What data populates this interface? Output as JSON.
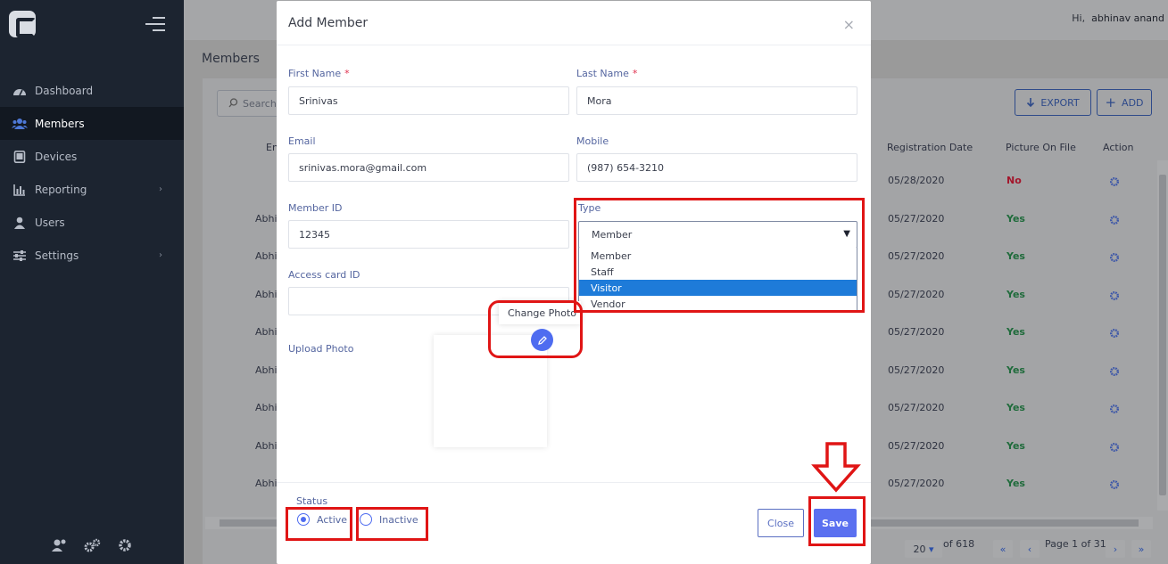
{
  "sidebar": {
    "items": [
      {
        "label": "Dashboard",
        "icon": "dashboard-icon",
        "chevron": false,
        "active": false
      },
      {
        "label": "Members",
        "icon": "users-icon",
        "chevron": false,
        "active": true
      },
      {
        "label": "Devices",
        "icon": "tablet-icon",
        "chevron": false,
        "active": false
      },
      {
        "label": "Reporting",
        "icon": "bar-chart-icon",
        "chevron": true,
        "active": false
      },
      {
        "label": "Users",
        "icon": "user-icon",
        "chevron": false,
        "active": false
      },
      {
        "label": "Settings",
        "icon": "sliders-icon",
        "chevron": true,
        "active": false
      }
    ],
    "chevron_glyph": "›"
  },
  "topbar": {
    "greeting": "Hi,",
    "username": "abhinav anand"
  },
  "page": {
    "title": "Members",
    "search_placeholder": "Search",
    "export_label": "EXPORT",
    "add_label": "ADD",
    "columns": {
      "email": "En",
      "registration": "Registration Date",
      "picture": "Picture On File",
      "action": "Action"
    },
    "rows": [
      {
        "name": "",
        "date": "05/28/2020",
        "picture": "No"
      },
      {
        "name": "Abhi",
        "date": "05/27/2020",
        "picture": "Yes"
      },
      {
        "name": "Abhi",
        "date": "05/27/2020",
        "picture": "Yes"
      },
      {
        "name": "Abhi",
        "date": "05/27/2020",
        "picture": "Yes"
      },
      {
        "name": "Abhi",
        "date": "05/27/2020",
        "picture": "Yes"
      },
      {
        "name": "Abhi",
        "date": "05/27/2020",
        "picture": "Yes"
      },
      {
        "name": "Abhi",
        "date": "05/27/2020",
        "picture": "Yes"
      },
      {
        "name": "Abhi",
        "date": "05/27/2020",
        "picture": "Yes"
      },
      {
        "name": "Abhi",
        "date": "05/27/2020",
        "picture": "Yes"
      }
    ],
    "pager": {
      "page_size": "20",
      "of_total": "of 618",
      "page_info": "Page 1 of 31"
    }
  },
  "modal": {
    "title": "Add Member",
    "close_glyph": "×",
    "first_name": {
      "label": "First Name",
      "value": "Srinivas"
    },
    "last_name": {
      "label": "Last Name",
      "value": "Mora"
    },
    "email": {
      "label": "Email",
      "value": "srinivas.mora@gmail.com"
    },
    "mobile": {
      "label": "Mobile",
      "value": "(987) 654-3210"
    },
    "member_id": {
      "label": "Member ID",
      "value": "12345"
    },
    "type": {
      "label": "Type",
      "value": "Member",
      "options": [
        "Member",
        "Staff",
        "Visitor",
        "Vendor"
      ],
      "highlighted": "Visitor"
    },
    "access_card": {
      "label": "Access card ID",
      "value": ""
    },
    "upload_photo_label": "Upload Photo",
    "change_photo_label": "Change Photo",
    "status": {
      "label": "Status",
      "active_label": "Active",
      "inactive_label": "Inactive",
      "selected": "Active"
    },
    "close_button": "Close",
    "save_button": "Save"
  },
  "colors": {
    "sidebar_bg": "#1c2430",
    "accent": "#5b70f0",
    "annotation": "#e01515",
    "dropdown_highlight": "#1e7bd9"
  }
}
